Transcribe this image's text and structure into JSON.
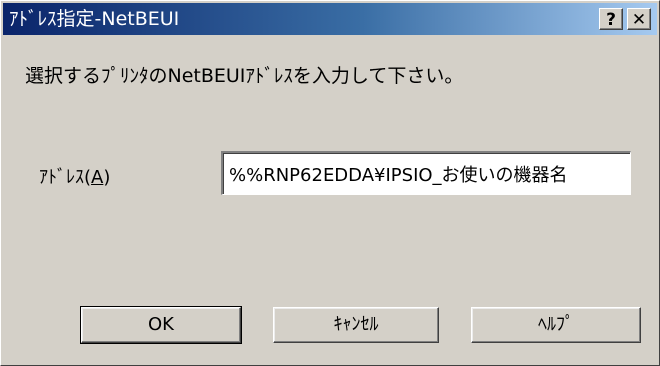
{
  "window": {
    "title": "ｱﾄﾞﾚｽ指定-NetBEUI",
    "help_glyph": "?",
    "close_glyph": "✕"
  },
  "dialog": {
    "instruction": "選択するﾌﾟﾘﾝﾀのNetBEUIｱﾄﾞﾚｽを入力して下さい。",
    "address_label_prefix": "ｱﾄﾞﾚｽ(",
    "address_label_accel": "A",
    "address_label_suffix": ")",
    "address_value": "%%RNP62EDDA¥IPSIO_お使いの機器名"
  },
  "buttons": {
    "ok": "OK",
    "cancel": "ｷｬﾝｾﾙ",
    "help": "ﾍﾙﾌﾟ"
  },
  "colors": {
    "title_start": "#0a246a",
    "title_end": "#a6caf0",
    "face": "#d4d0c8"
  }
}
